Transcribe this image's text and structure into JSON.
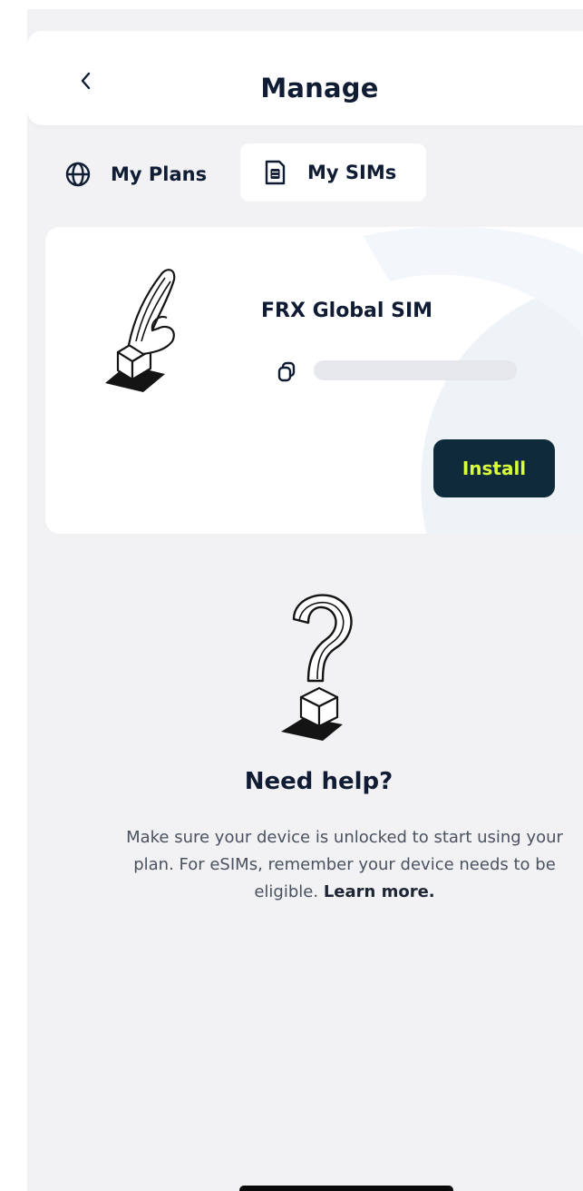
{
  "header": {
    "title": "Manage",
    "back_icon": "chevron-left-icon"
  },
  "tabs": [
    {
      "label": "My Plans",
      "icon": "globe-icon",
      "selected": false
    },
    {
      "label": "My SIMs",
      "icon": "sim-card-icon",
      "selected": true
    }
  ],
  "sim_card": {
    "name": "FRX Global SIM",
    "copy_icon": "copy-icon",
    "install_label": "Install"
  },
  "help": {
    "title": "Need help?",
    "text": "Make sure your device is unlocked to start using your plan. For eSIMs, remember your device needs to be eligible.",
    "link": "Learn more."
  },
  "colors": {
    "background": "#f2f2f4",
    "card": "#ffffff",
    "primary_text": "#0f1c33",
    "install_bg": "#0f2a3a",
    "install_text": "#d9ff3c",
    "placeholder": "#e6e7ea"
  }
}
